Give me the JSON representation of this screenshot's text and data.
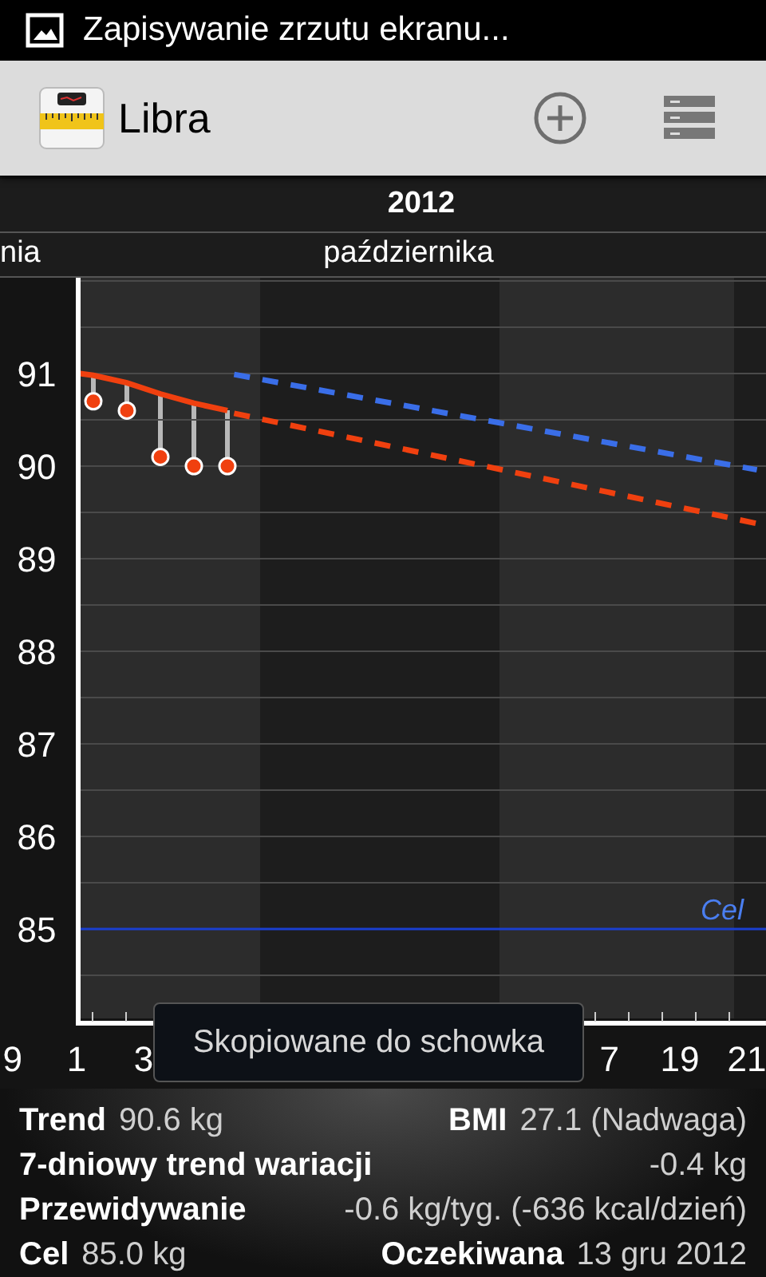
{
  "status_bar": {
    "notification": "Zapisywanie zrzutu ekranu..."
  },
  "action_bar": {
    "title": "Libra"
  },
  "timeline": {
    "year": "2012",
    "months": [
      "nia",
      "października"
    ]
  },
  "chart": {
    "chart_data": {
      "type": "line",
      "x": [
        1.1,
        1.5,
        2.5,
        3.5,
        4.5,
        5.5,
        5.7,
        21.3
      ],
      "series": [
        {
          "line_style": "solid",
          "color": "#f0400f",
          "values": [
            91.0,
            90.98,
            90.9,
            90.78,
            90.68,
            90.6,
            null,
            null
          ]
        },
        {
          "line_style": "dashed",
          "color": "#f0400f",
          "values": [
            null,
            null,
            null,
            null,
            null,
            null,
            90.57,
            89.38
          ]
        },
        {
          "line_style": "dashed",
          "color": "#3a6ee8",
          "values": [
            null,
            null,
            null,
            null,
            null,
            null,
            90.99,
            89.96
          ]
        },
        {
          "type": "scatter",
          "marker": "circle",
          "color": "#f0400f",
          "values": [
            null,
            90.7,
            90.6,
            90.1,
            90.0,
            90.0,
            null,
            null
          ]
        }
      ],
      "xlim": [
        1,
        21.57
      ],
      "ylim": [
        84,
        92
      ],
      "yticks": [
        85,
        86,
        87,
        88,
        89,
        90,
        91
      ],
      "xticks": [
        1,
        3,
        19,
        21
      ],
      "grid": true,
      "ref_lines": [
        {
          "axis": "y",
          "value": 85,
          "label": "Cel",
          "color": "#1a3fd0"
        }
      ]
    },
    "partial_tick_labels": [
      "9",
      "7"
    ]
  },
  "toast": {
    "text": "Skopiowane do schowka"
  },
  "stats": [
    {
      "kind": "pairs",
      "left": {
        "label": "Trend",
        "value": "90.6 kg"
      },
      "right": {
        "label": "BMI",
        "value": "27.1 (Nadwaga)"
      }
    },
    {
      "kind": "spread",
      "label": "7-dniowy trend wariacji",
      "value": "-0.4 kg"
    },
    {
      "kind": "spread",
      "label": "Przewidywanie",
      "value": "-0.6 kg/tyg. (-636 kcal/dzień)"
    },
    {
      "kind": "pairs",
      "left": {
        "label": "Cel",
        "value": "85.0 kg"
      },
      "right": {
        "label": "Oczekiwana",
        "value": "13 gru 2012"
      }
    }
  ]
}
